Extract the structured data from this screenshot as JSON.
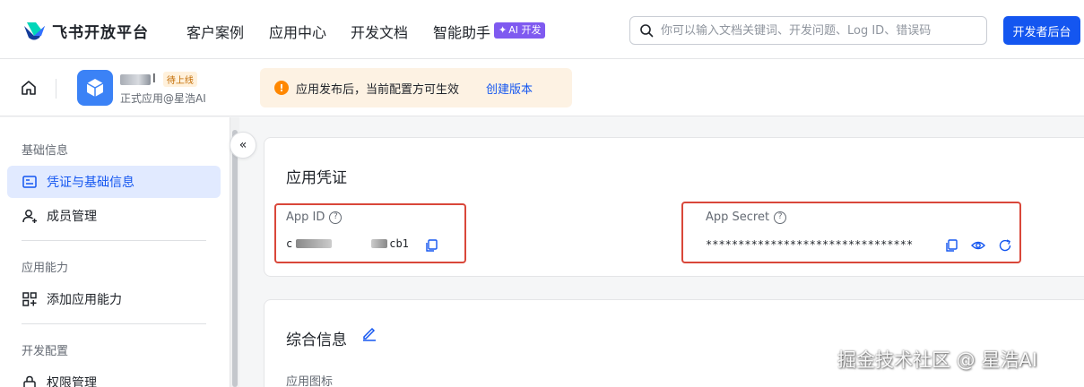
{
  "brand": {
    "name": "飞书开放平台"
  },
  "nav": {
    "items": [
      "客户案例",
      "应用中心",
      "开发文档",
      "智能助手"
    ],
    "ai_badge": "AI 开发"
  },
  "search": {
    "placeholder": "你可以输入文档关键词、开发问题、Log ID、错误码"
  },
  "dev_console_button": "开发者后台",
  "app": {
    "name_suffix": "I",
    "status_tag": "待上线",
    "subtitle": "正式应用@星浩AI"
  },
  "notice": {
    "text": "应用发布后，当前配置方可生效",
    "link": "创建版本"
  },
  "sidebar": {
    "groups": [
      {
        "title": "基础信息",
        "items": [
          {
            "label": "凭证与基础信息",
            "active": true
          },
          {
            "label": "成员管理"
          }
        ]
      },
      {
        "title": "应用能力",
        "items": [
          {
            "label": "添加应用能力"
          }
        ]
      },
      {
        "title": "开发配置",
        "items": [
          {
            "label": "权限管理"
          }
        ]
      }
    ]
  },
  "credentials": {
    "title": "应用凭证",
    "app_id_label": "App ID",
    "app_id_prefix": "c",
    "app_id_suffix": "cb1",
    "app_secret_label": "App Secret",
    "app_secret_value": "********************************"
  },
  "general": {
    "title": "综合信息",
    "app_icon_label": "应用图标"
  },
  "watermark": "掘金技术社区 @ 星浩AI",
  "colors": {
    "primary": "#1456f0",
    "highlight_box": "#d9473a",
    "notice_bg": "#fdf2e3",
    "active_bg": "#e1eaff"
  }
}
